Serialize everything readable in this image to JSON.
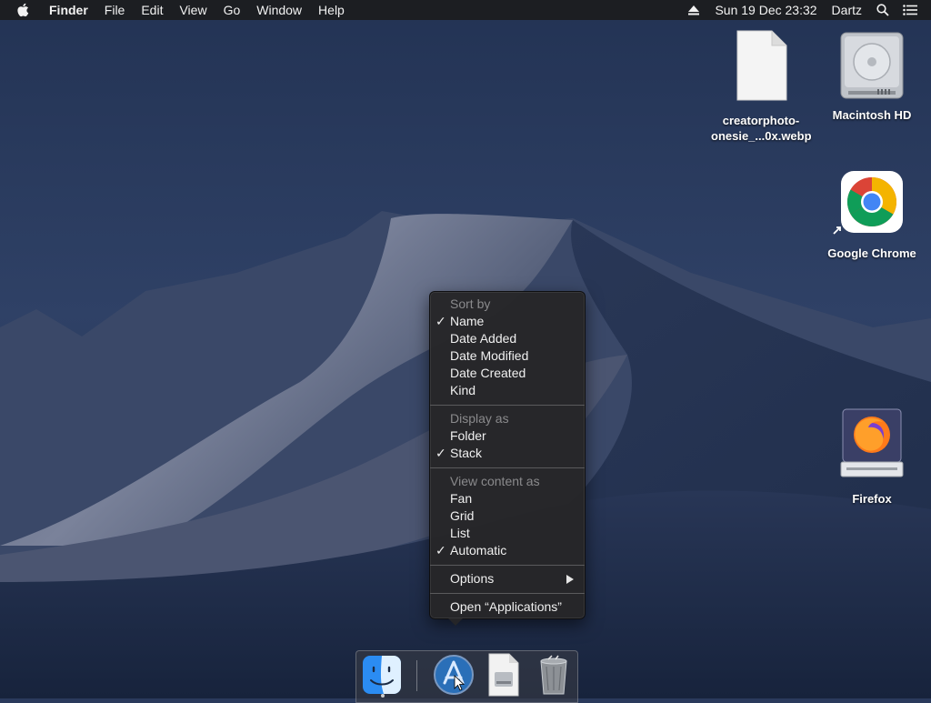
{
  "menubar": {
    "app_name": "Finder",
    "items": [
      "File",
      "Edit",
      "View",
      "Go",
      "Window",
      "Help"
    ],
    "clock": "Sun 19 Dec  23:32",
    "user": "Dartz"
  },
  "desktop": {
    "icons": [
      {
        "label_line1": "creatorphoto-",
        "label_line2": "onesie_...0x.webp",
        "icon": "document-icon"
      },
      {
        "label_line1": "Macintosh HD",
        "label_line2": "",
        "icon": "hard-drive-icon"
      },
      {
        "label_line1": "Google Chrome",
        "label_line2": "",
        "icon": "chrome-icon"
      },
      {
        "label_line1": "Firefox",
        "label_line2": "",
        "icon": "firefox-icon"
      }
    ]
  },
  "context_menu": {
    "sort_by": {
      "header": "Sort by",
      "items": [
        {
          "label": "Name",
          "checked": true
        },
        {
          "label": "Date Added",
          "checked": false
        },
        {
          "label": "Date Modified",
          "checked": false
        },
        {
          "label": "Date Created",
          "checked": false
        },
        {
          "label": "Kind",
          "checked": false
        }
      ]
    },
    "display_as": {
      "header": "Display as",
      "items": [
        {
          "label": "Folder",
          "checked": false
        },
        {
          "label": "Stack",
          "checked": true
        }
      ]
    },
    "view_content_as": {
      "header": "View content as",
      "items": [
        {
          "label": "Fan",
          "checked": false
        },
        {
          "label": "Grid",
          "checked": false
        },
        {
          "label": "List",
          "checked": false
        },
        {
          "label": "Automatic",
          "checked": true
        }
      ]
    },
    "options": "Options",
    "open": "Open “Applications”",
    "checkmark": "✓"
  },
  "dock": {
    "items": [
      "finder-icon",
      "applications-folder-icon",
      "document-icon",
      "trash-icon"
    ]
  }
}
